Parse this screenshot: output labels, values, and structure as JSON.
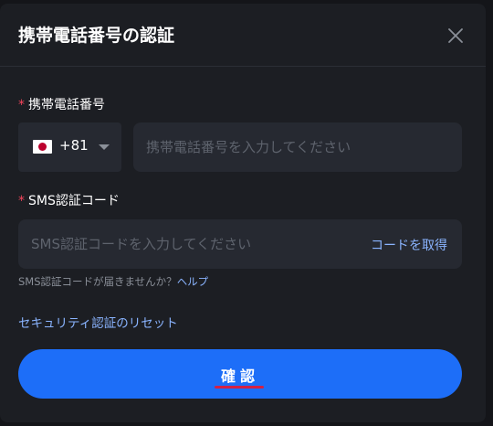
{
  "dialog": {
    "title": "携帯電話番号の認証",
    "close_icon": "close-icon"
  },
  "phone": {
    "required_mark": "*",
    "label": "携帯電話番号",
    "country_flag_icon": "japan-flag-icon",
    "dial_code": "+81",
    "placeholder": "携帯電話番号を入力してください"
  },
  "sms": {
    "required_mark": "*",
    "label": "SMS認証コード",
    "placeholder": "SMS認証コードを入力してください",
    "get_code_label": "コードを取得",
    "hint_text": "SMS認証コードが届きませんか？",
    "help_link": "ヘルプ"
  },
  "reset_link": "セキュリティ認証のリセット",
  "confirm_button": "確認",
  "colors": {
    "accent": "#1d6ef8",
    "link": "#8ab4ff",
    "required": "#f5455c",
    "annotation_underline": "#d22146"
  }
}
